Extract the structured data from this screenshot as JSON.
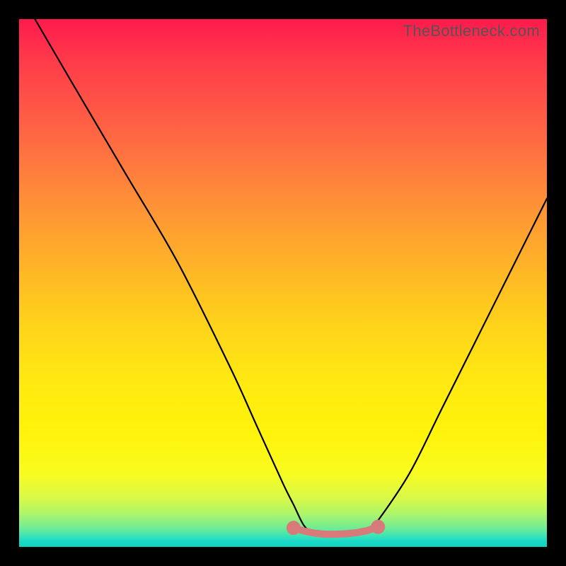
{
  "watermark": "TheBottleneck.com",
  "chart_data": {
    "type": "line",
    "title": "",
    "xlabel": "",
    "ylabel": "",
    "xlim": [
      0,
      100
    ],
    "ylim": [
      0,
      100
    ],
    "series": [
      {
        "name": "bottleneck-curve",
        "x": [
          3,
          10,
          20,
          30,
          40,
          45,
          50,
          52,
          54,
          56,
          58,
          60,
          62,
          64,
          66,
          68,
          74,
          80,
          88,
          96,
          100
        ],
        "values": [
          100,
          88,
          71,
          54,
          34,
          23,
          12,
          8,
          4,
          2.5,
          2,
          2,
          2,
          2.3,
          3,
          5,
          14,
          26,
          42,
          58,
          66
        ]
      },
      {
        "name": "optimal-band-marker",
        "x": [
          52,
          54,
          56,
          58,
          60,
          62,
          64,
          66,
          68
        ],
        "values": [
          3.6,
          3.0,
          2.6,
          2.4,
          2.4,
          2.5,
          2.7,
          3.1,
          3.8
        ]
      }
    ],
    "colors": {
      "curve": "#000000",
      "marker": "#d87a7a"
    }
  }
}
